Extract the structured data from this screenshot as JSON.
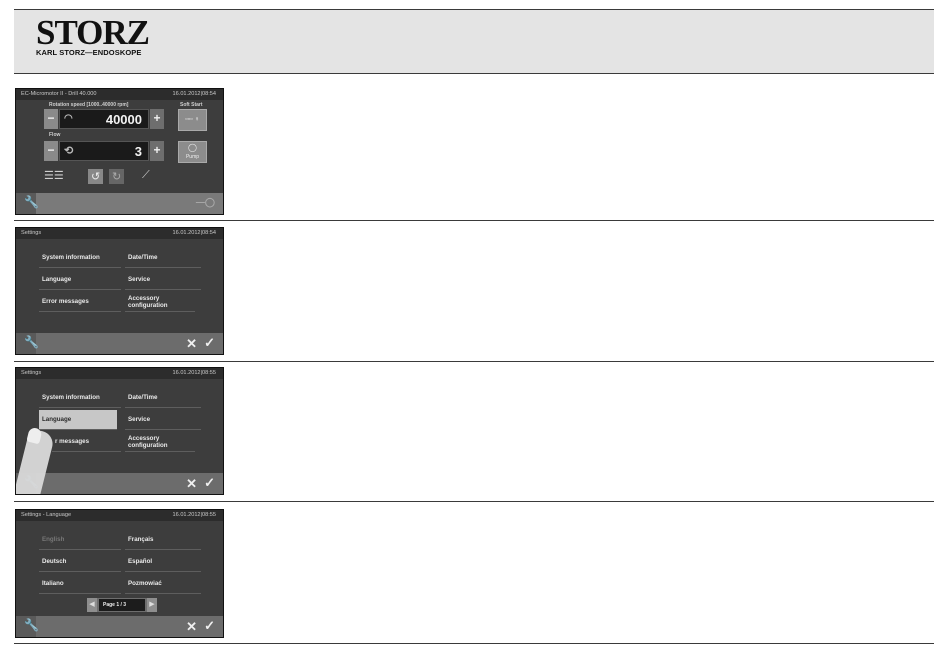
{
  "header": {
    "brand": "STORZ",
    "brand_sub": "KARL STORZ—ENDOSKOPE"
  },
  "screen1": {
    "title": "EC-Micromotor II - Drill 40.000",
    "datetime": "16.01.2012|08:54",
    "speed_label": "Rotation speed  [1000..40000 rpm]",
    "speed_value": "40000",
    "flow_label": "Flow",
    "flow_value": "3",
    "soft_start_label": "Soft Start",
    "pump_label": "Pump",
    "minus": "−",
    "plus": "+"
  },
  "screen2": {
    "title": "Settings",
    "datetime": "16.01.2012|08:54",
    "items": [
      "System information",
      "Date/Time",
      "Language",
      "Service",
      "Error messages",
      "Accessory configuration"
    ]
  },
  "screen3": {
    "title": "Settings",
    "datetime": "16.01.2012|08:55",
    "items": [
      "System information",
      "Date/Time",
      "Language",
      "Service",
      "r messages",
      "Accessory configuration"
    ]
  },
  "screen4": {
    "title": "Settings - Language",
    "datetime": "16.01.2012|08:55",
    "items": [
      "English",
      "Français",
      "Deutsch",
      "Español",
      "Italiano",
      "Pozmowiać"
    ],
    "page": "Page 1 / 3"
  },
  "bar": {
    "wrench": "🔧",
    "cancel": "✕",
    "confirm": "✓"
  }
}
